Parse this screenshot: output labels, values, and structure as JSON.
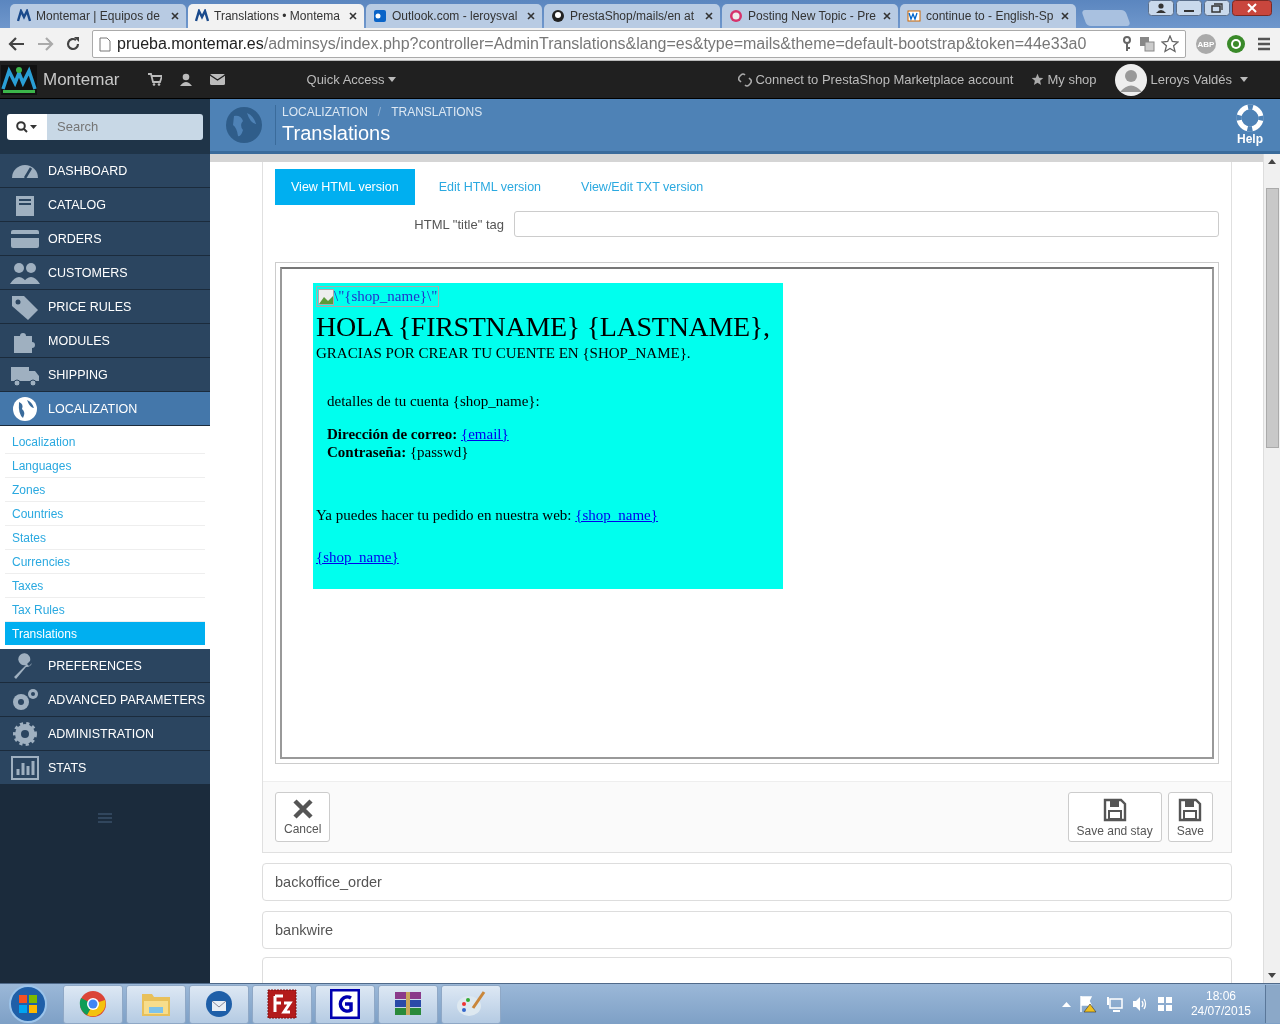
{
  "browser": {
    "tabs": [
      {
        "title": "Montemar | Equipos de",
        "selected": false
      },
      {
        "title": "Translations • Montema",
        "selected": true
      },
      {
        "title": "Outlook.com - leroysval",
        "selected": false
      },
      {
        "title": "PrestaShop/mails/en at",
        "selected": false
      },
      {
        "title": "Posting New Topic - Pre",
        "selected": false
      },
      {
        "title": "continue to - English-Sp",
        "selected": false
      }
    ],
    "url": {
      "host": "prueba.montemar.es",
      "path": "/adminsys/index.php?controller=AdminTranslations&lang=es&type=mails&theme=default-bootstrap&token=44e33a0"
    },
    "extension_badge": "ABP"
  },
  "header": {
    "brand": "Montemar",
    "quick_access": "Quick Access",
    "connect": "Connect to PrestaShop Marketplace account",
    "my_shop": "My shop",
    "user": "Leroys Valdés"
  },
  "sidebar": {
    "search": {
      "placeholder": "Search"
    },
    "items": [
      {
        "label": "DASHBOARD",
        "selected": false
      },
      {
        "label": "CATALOG",
        "selected": false
      },
      {
        "label": "ORDERS",
        "selected": false
      },
      {
        "label": "CUSTOMERS",
        "selected": false
      },
      {
        "label": "PRICE RULES",
        "selected": false
      },
      {
        "label": "MODULES",
        "selected": false
      },
      {
        "label": "SHIPPING",
        "selected": false
      },
      {
        "label": "LOCALIZATION",
        "selected": true,
        "expanded": true,
        "children": [
          {
            "label": "Localization",
            "selected": false
          },
          {
            "label": "Languages",
            "selected": false
          },
          {
            "label": "Zones",
            "selected": false
          },
          {
            "label": "Countries",
            "selected": false
          },
          {
            "label": "States",
            "selected": false
          },
          {
            "label": "Currencies",
            "selected": false
          },
          {
            "label": "Taxes",
            "selected": false
          },
          {
            "label": "Tax Rules",
            "selected": false
          },
          {
            "label": "Translations",
            "selected": true
          }
        ]
      },
      {
        "label": "PREFERENCES",
        "selected": false
      },
      {
        "label": "ADVANCED PARAMETERS",
        "selected": false
      },
      {
        "label": "ADMINISTRATION",
        "selected": false
      },
      {
        "label": "STATS",
        "selected": false
      }
    ]
  },
  "page_header": {
    "breadcrumb": [
      "LOCALIZATION",
      "TRANSLATIONS"
    ],
    "breadcrumb_separator": "/",
    "title": "Translations",
    "help": "Help"
  },
  "editor": {
    "tabs": [
      {
        "label": "View HTML version",
        "selected": true
      },
      {
        "label": "Edit HTML version",
        "selected": false
      },
      {
        "label": "View/Edit TXT version",
        "selected": false
      }
    ],
    "title_tag": {
      "label": "HTML \"title\" tag"
    },
    "preview": {
      "image_alt": "\\\"{shop_name}\\\"",
      "heading": "HOLA {FIRSTNAME} {LASTNAME},",
      "subheading": "GRACIAS POR CREAR TU CUENTE EN {SHOP_NAME}.",
      "details": "detalles de tu cuenta {shop_name}:",
      "email_label": "Dirección de correo:",
      "email": "{email}",
      "password_label": "Contraseña:",
      "password": "{passwd}",
      "order_text": "Ya puedes hacer tu pedido en nuestra web:",
      "order_link": "{shop_name}",
      "footer_link": "{shop_name}"
    },
    "buttons": {
      "cancel": "Cancel",
      "save_and_stay": "Save and stay",
      "save": "Save"
    }
  },
  "sections": [
    "backoffice_order",
    "bankwire"
  ],
  "taskbar": {
    "time": "18:06",
    "date": "24/07/2015"
  }
}
